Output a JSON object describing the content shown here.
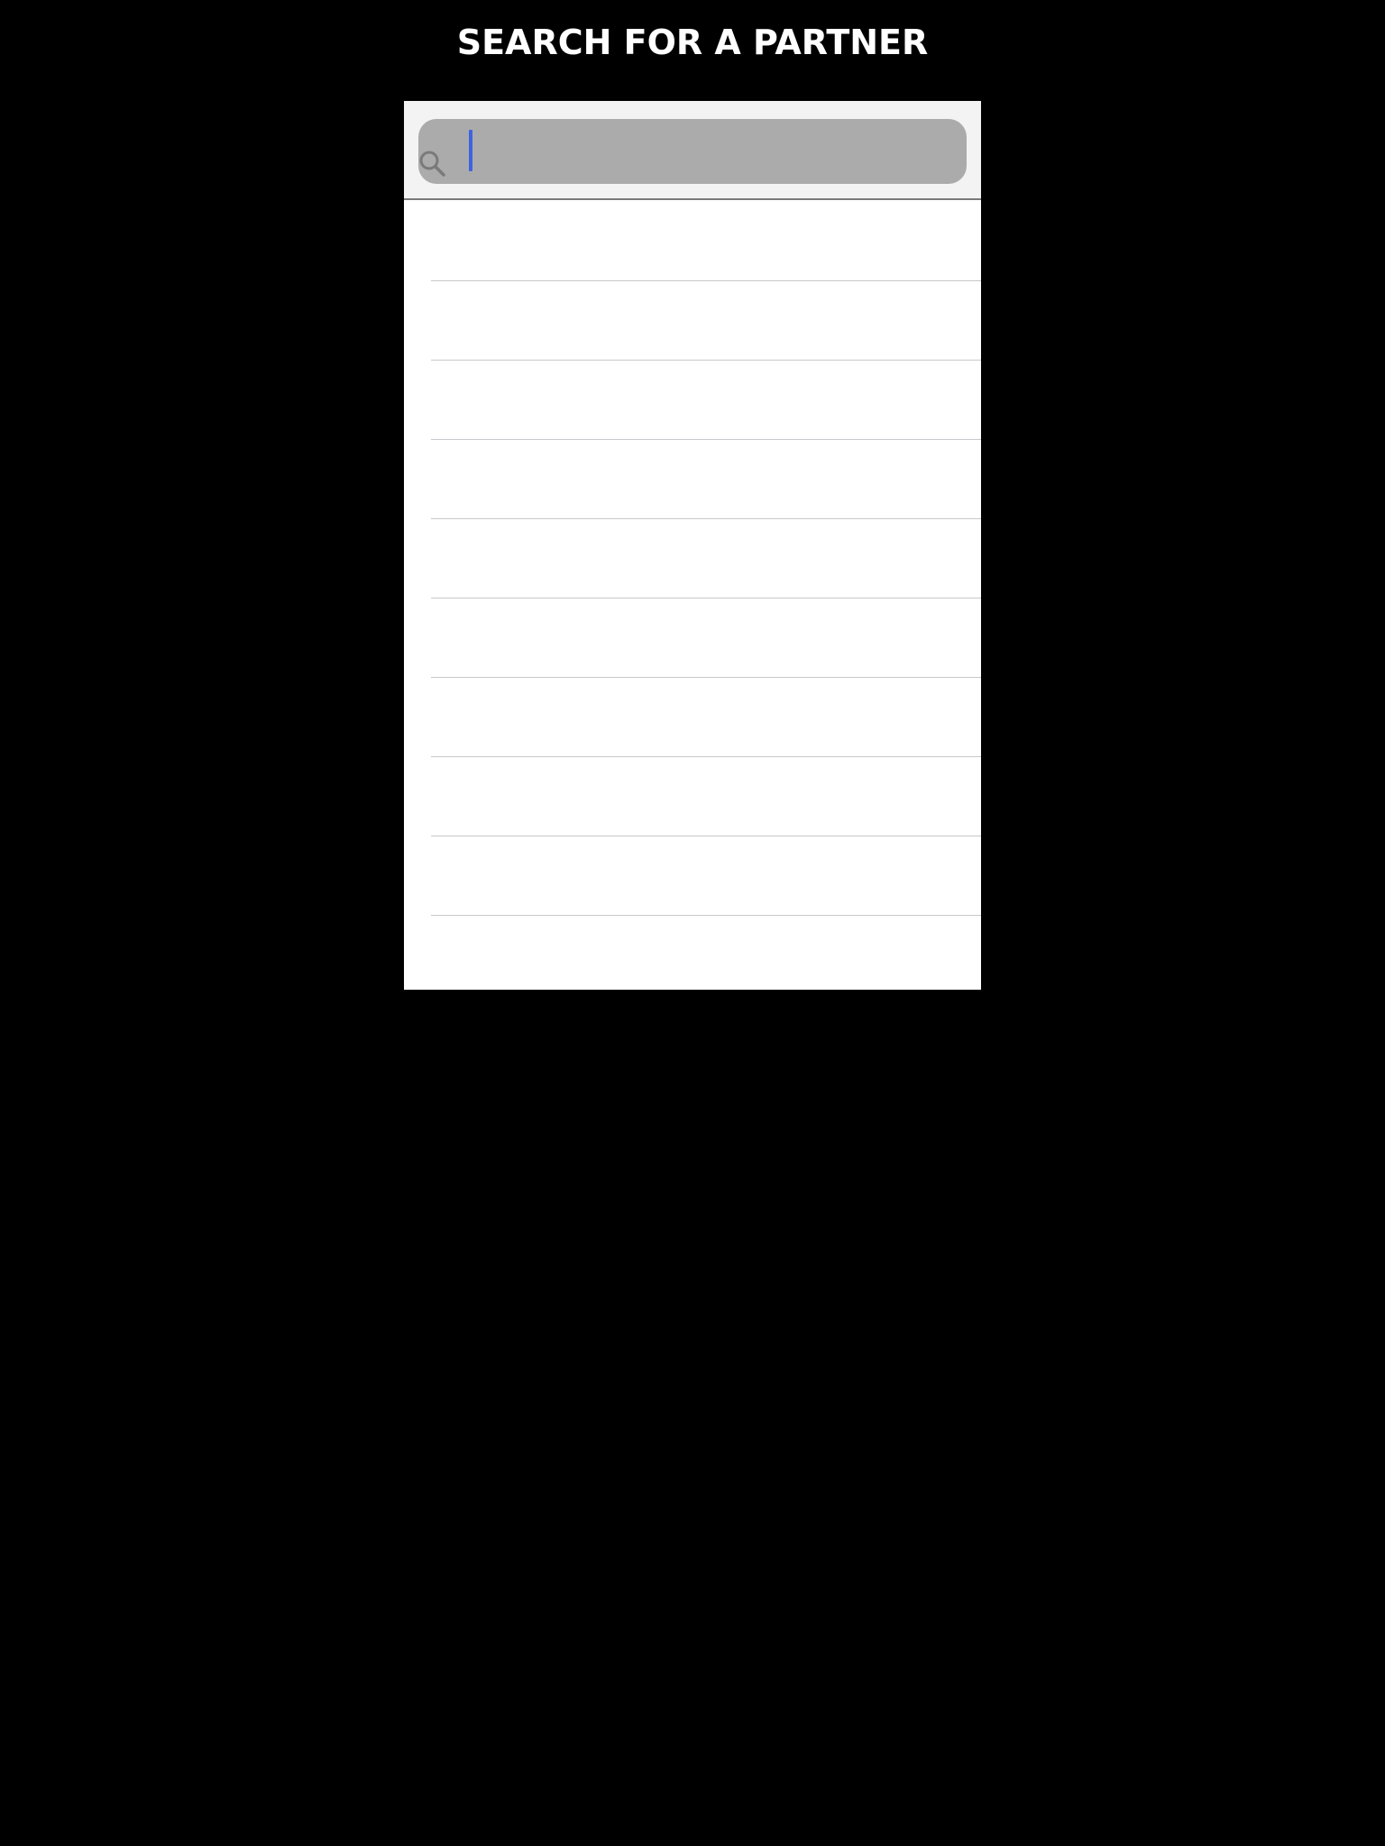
{
  "header": {
    "title": "SEARCH FOR A PARTNER"
  },
  "search": {
    "value": "",
    "placeholder": "",
    "icon": "search-icon"
  },
  "results": {
    "rows": [
      "",
      "",
      "",
      "",
      "",
      "",
      "",
      "",
      "",
      ""
    ]
  },
  "colors": {
    "background": "#000000",
    "title": "#ffffff",
    "panel": "#ffffff",
    "search_bar": "#f3f3f3",
    "search_field": "#ababab",
    "caret": "#3d63e0",
    "separator": "#c8c8cc"
  }
}
